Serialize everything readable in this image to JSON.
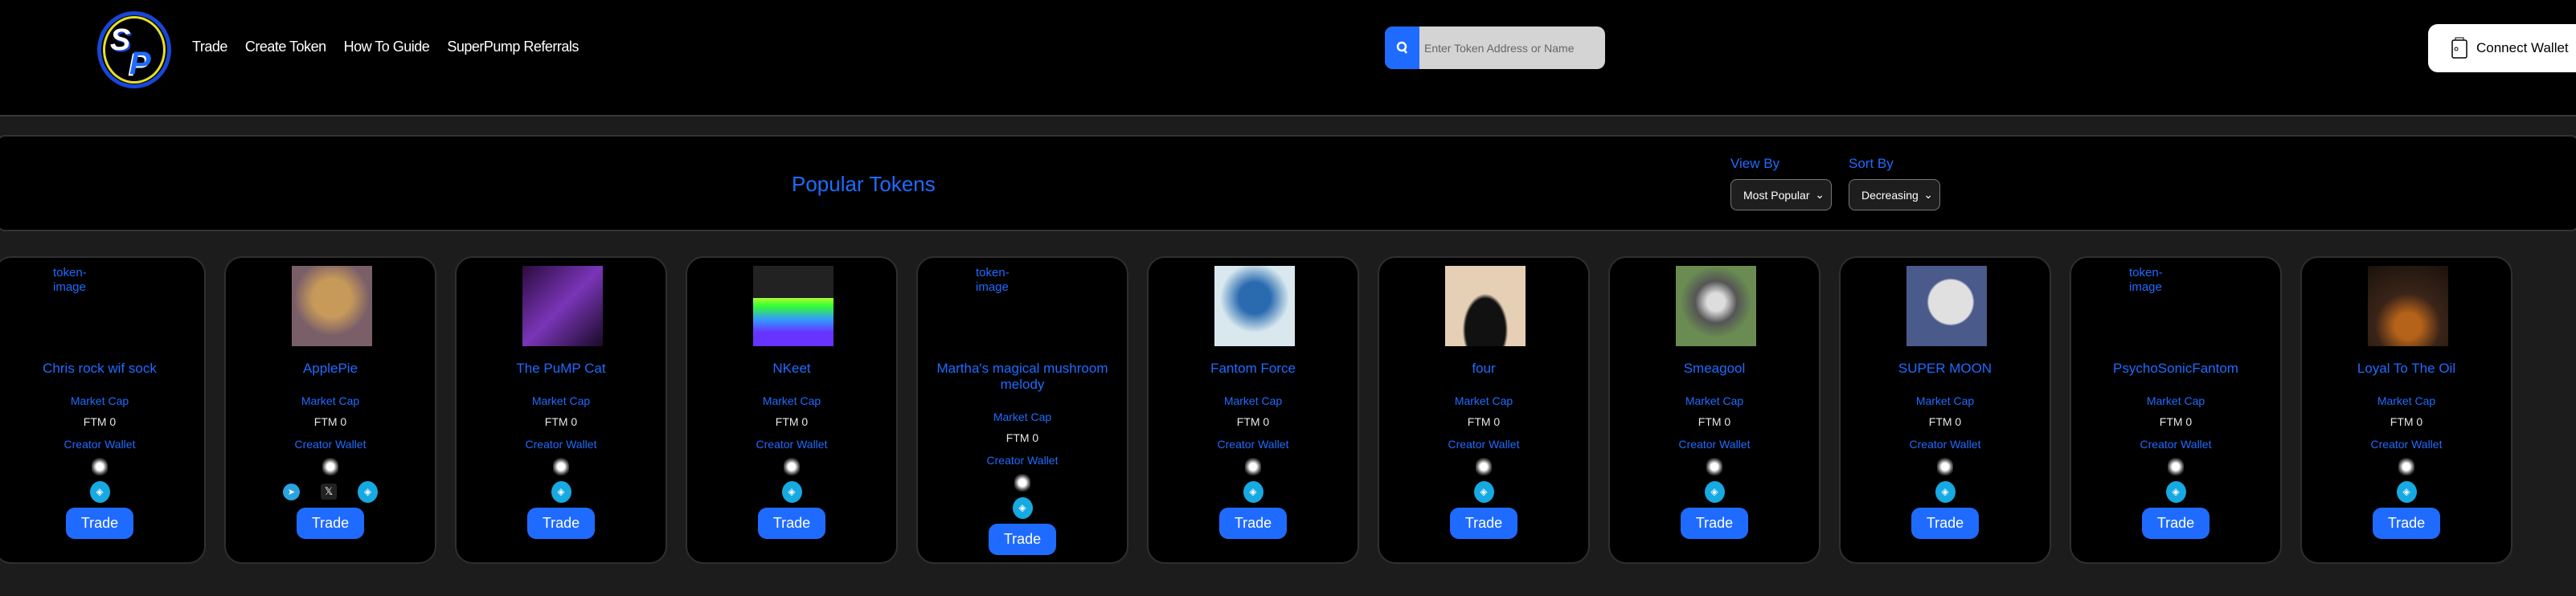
{
  "header": {
    "logo_text": "SP",
    "nav": [
      "Trade",
      "Create Token",
      "How To Guide",
      "SuperPump Referrals"
    ],
    "search_placeholder": "Enter Token Address or Name",
    "connect_wallet": "Connect Wallet"
  },
  "panel": {
    "title": "Popular Tokens",
    "view_by_label": "View By",
    "view_by_value": "Most Popular",
    "sort_by_label": "Sort By",
    "sort_by_value": "Decreasing"
  },
  "labels": {
    "market_cap": "Market Cap",
    "creator_wallet": "Creator Wallet",
    "trade": "Trade",
    "broken_image_alt": "token-image"
  },
  "colors": {
    "accent": "#1f6bff",
    "background": "#1c1c1c",
    "card": "#000000",
    "fantom": "#17a9e1"
  },
  "tokens": [
    {
      "name": "Chris rock wif sock",
      "market_cap": "FTM 0",
      "image": "broken",
      "socials": [
        "fantom"
      ]
    },
    {
      "name": "ApplePie",
      "market_cap": "FTM 0",
      "image": "pie-character",
      "socials": [
        "telegram",
        "x",
        "fantom"
      ]
    },
    {
      "name": "The PuMP Cat",
      "market_cap": "FTM 0",
      "image": "space-cat",
      "socials": [
        "fantom"
      ]
    },
    {
      "name": "NKeet",
      "market_cap": "FTM 0",
      "image": "nyan-cat",
      "socials": [
        "fantom"
      ]
    },
    {
      "name": "Martha's magical mushroom melody",
      "market_cap": "FTM 0",
      "image": "broken",
      "socials": [
        "fantom"
      ]
    },
    {
      "name": "Fantom Force",
      "market_cap": "FTM 0",
      "image": "hooded-figure",
      "socials": [
        "fantom"
      ]
    },
    {
      "name": "four",
      "market_cap": "FTM 0",
      "image": "man-photo",
      "socials": [
        "fantom"
      ]
    },
    {
      "name": "Smeagool",
      "market_cap": "FTM 0",
      "image": "gollum",
      "socials": [
        "fantom"
      ]
    },
    {
      "name": "SUPER MOON",
      "market_cap": "FTM 0",
      "image": "moon",
      "socials": [
        "fantom"
      ]
    },
    {
      "name": "PsychoSonicFantom",
      "market_cap": "FTM 0",
      "image": "broken",
      "socials": [
        "fantom"
      ]
    },
    {
      "name": "Loyal To The Oil",
      "market_cap": "FTM 0",
      "image": "honey-jar",
      "socials": [
        "fantom"
      ]
    }
  ]
}
